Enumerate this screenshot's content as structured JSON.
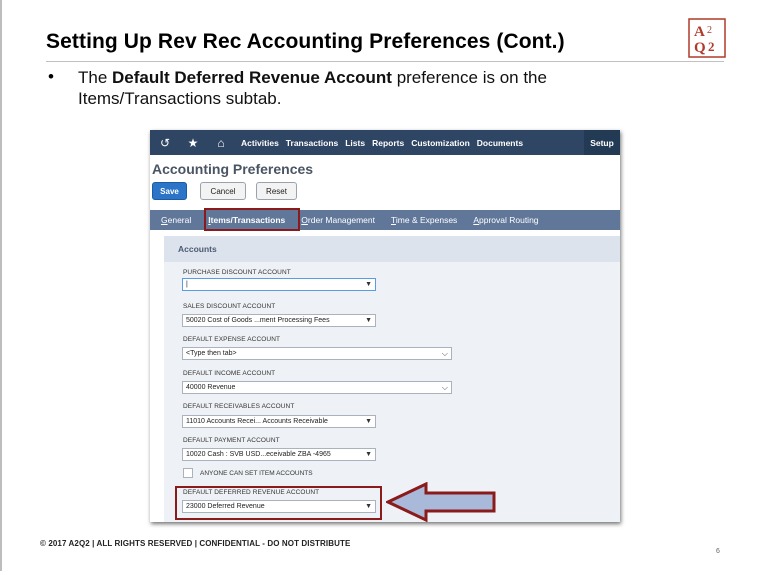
{
  "slide": {
    "title": "Setting Up Rev Rec Accounting Preferences (Cont.)",
    "bullet_symbol": "•",
    "bullet_pre": "The ",
    "bullet_bold": "Default Deferred Revenue Account",
    "bullet_post": " preference is on the Items/Transactions subtab.",
    "footer": "© 2017 A2Q2 | ALL RIGHTS RESERVED | CONFIDENTIAL - DO NOT DISTRIBUTE",
    "page_number": "6",
    "logo_text": "A2Q2"
  },
  "navbar": {
    "items": [
      "Activities",
      "Transactions",
      "Lists",
      "Reports",
      "Customization",
      "Documents"
    ],
    "setup": "Setup"
  },
  "page": {
    "title": "Accounting Preferences",
    "save": "Save",
    "cancel": "Cancel",
    "reset": "Reset"
  },
  "tabs": [
    {
      "first": "G",
      "rest": "eneral"
    },
    {
      "first": "I",
      "rest": "tems/Transactions"
    },
    {
      "first": "O",
      "rest": "rder Management"
    },
    {
      "first": "T",
      "rest": "ime & Expenses"
    },
    {
      "first": "A",
      "rest": "pproval Routing"
    }
  ],
  "section": {
    "title": "Accounts"
  },
  "fields": [
    {
      "label": "PURCHASE DISCOUNT ACCOUNT",
      "value": "|"
    },
    {
      "label": "SALES DISCOUNT ACCOUNT",
      "value": "50020 Cost of Goods ...ment Processing Fees"
    },
    {
      "label": "DEFAULT EXPENSE ACCOUNT",
      "value": "<Type then tab>"
    },
    {
      "label": "DEFAULT INCOME ACCOUNT",
      "value": "40000 Revenue"
    },
    {
      "label": "DEFAULT RECEIVABLES ACCOUNT",
      "value": "11010 Accounts Recei... Accounts Receivable"
    },
    {
      "label": "DEFAULT PAYMENT ACCOUNT",
      "value": "10020 Cash : SVB USD...eceivable ZBA -4965"
    },
    {
      "label": "DEFAULT DEFERRED REVENUE ACCOUNT",
      "value": "23000 Deferred Revenue"
    }
  ],
  "checkbox": {
    "label": "ANYONE CAN SET ITEM ACCOUNTS"
  },
  "colors": {
    "nav": "#2f4564",
    "tabbar": "#607799",
    "highlight": "#8b1a1a",
    "arrow_fill": "#a9b9da"
  }
}
